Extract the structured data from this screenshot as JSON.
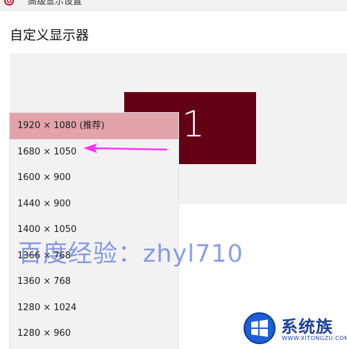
{
  "window": {
    "title": "高级显示设置",
    "icon": "gear-icon"
  },
  "page": {
    "heading": "自定义显示器"
  },
  "display": {
    "monitor_label": "1",
    "monitor_color": "#640015"
  },
  "resolution_dropdown": {
    "items": [
      {
        "label": "1920 × 1080 (推荐)",
        "selected": true
      },
      {
        "label": "1680 × 1050",
        "selected": false
      },
      {
        "label": "1600 × 900",
        "selected": false
      },
      {
        "label": "1440 × 900",
        "selected": false
      },
      {
        "label": "1400 × 1050",
        "selected": false
      },
      {
        "label": "1366 × 768",
        "selected": false
      },
      {
        "label": "1360 × 768",
        "selected": false
      },
      {
        "label": "1280 × 1024",
        "selected": false
      },
      {
        "label": "1280 × 960",
        "selected": false
      }
    ],
    "selected_color": "#e2a3ab"
  },
  "annotation": {
    "arrow_color": "#ff33ff",
    "watermark": "百度经验：zhyl710"
  },
  "logo": {
    "name_cn": "系统族",
    "url_text": "WWW.XITONGZU.COM"
  }
}
